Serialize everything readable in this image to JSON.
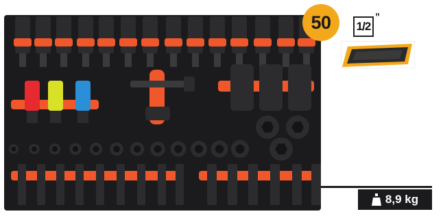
{
  "badge": {
    "count": "50",
    "color": "#f3a81c"
  },
  "drive": {
    "size": "1/2",
    "unit": "”"
  },
  "weight": {
    "label": "8,9 kg",
    "icon": "weight-icon"
  },
  "colors": {
    "tray": "#1b1b1d",
    "foam_accent": "#f0572a",
    "badge": "#f3a81c"
  },
  "sockets": {
    "colored_impact": [
      "red",
      "yellow",
      "blue"
    ]
  }
}
